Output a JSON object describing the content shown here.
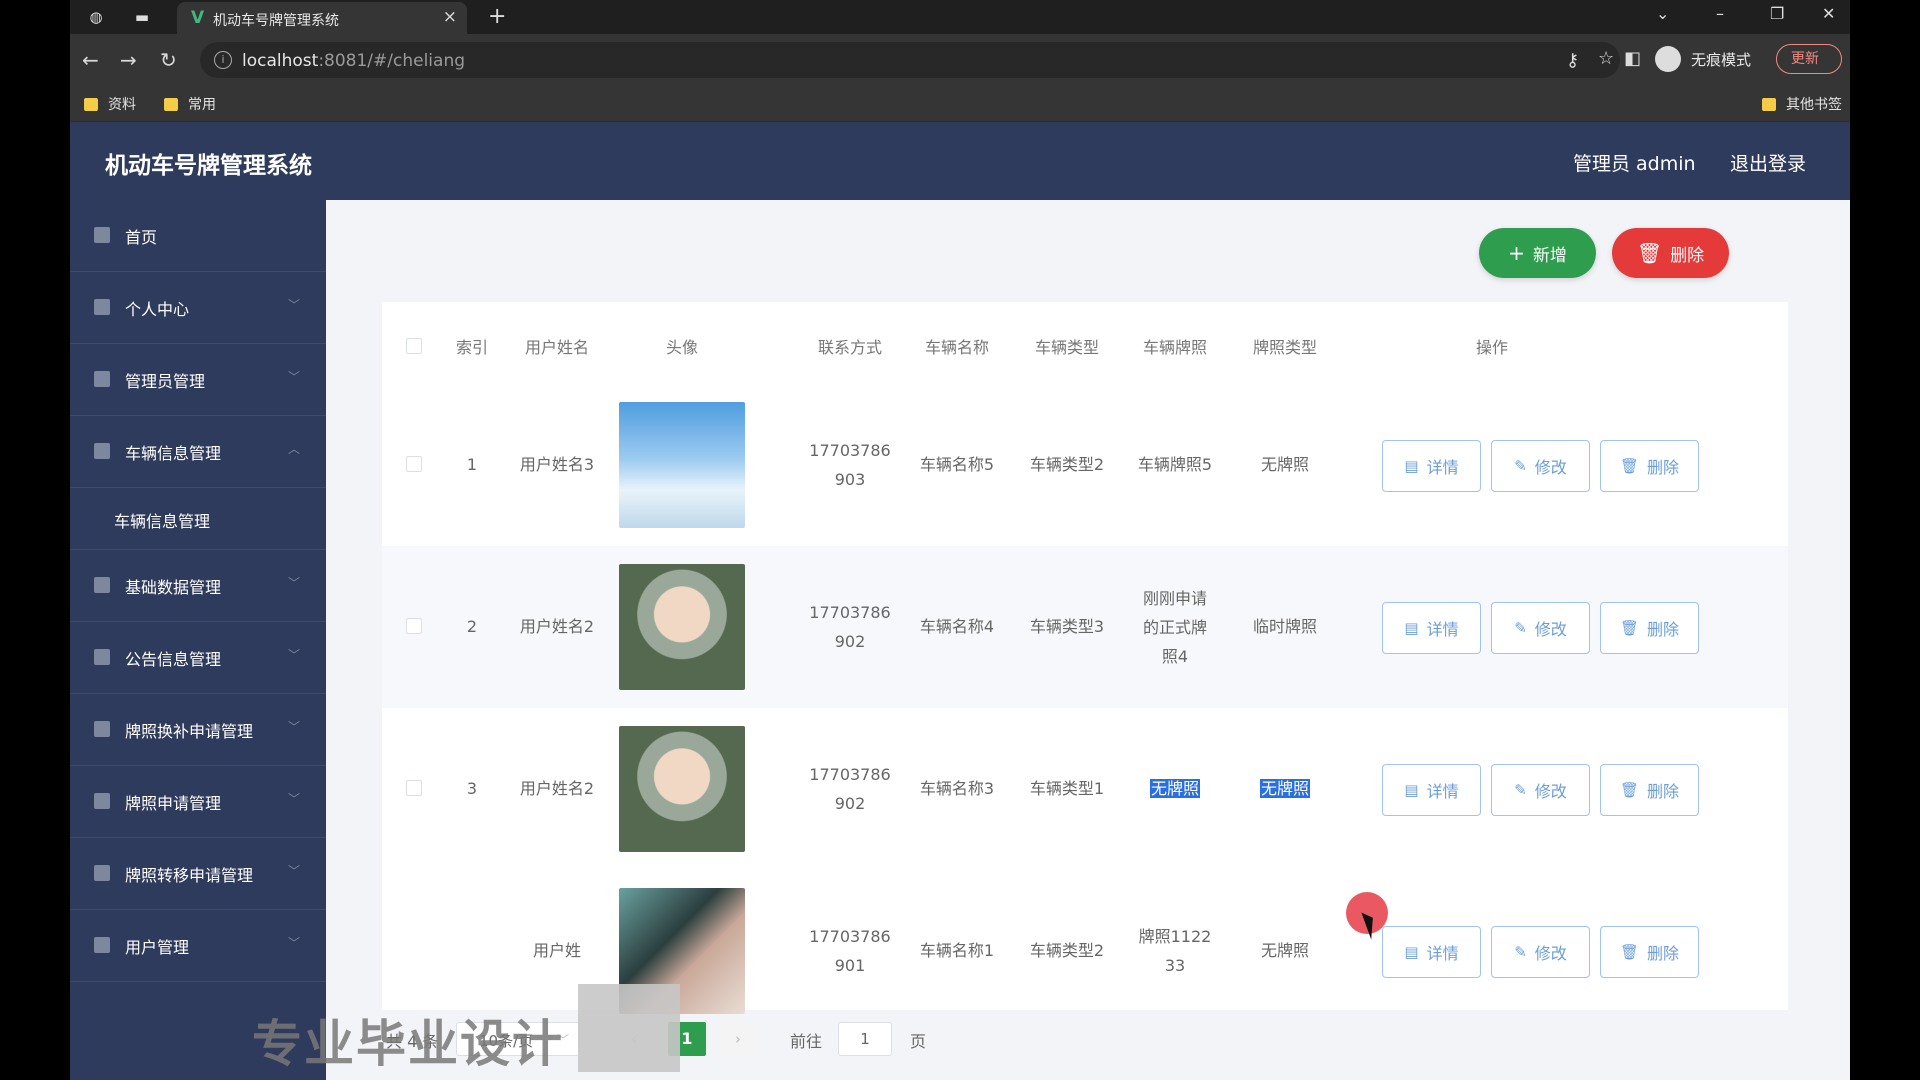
{
  "browser": {
    "tab_title": "机动车号牌管理系统",
    "url_host": "localhost",
    "url_rest": ":8081/#/cheliang",
    "incognito_label": "无痕模式",
    "update_label": "更新",
    "bookmarks": [
      "资料",
      "常用"
    ],
    "other_bookmarks": "其他书签"
  },
  "header": {
    "title": "机动车号牌管理系统",
    "admin": "管理员 admin",
    "logout": "退出登录"
  },
  "sidebar": {
    "items": [
      {
        "label": "首页",
        "icon": "home-icon"
      },
      {
        "label": "个人中心",
        "icon": "user-icon"
      },
      {
        "label": "管理员管理",
        "icon": "monitor-icon"
      },
      {
        "label": "车辆信息管理",
        "icon": "chat-icon"
      },
      {
        "label": "车辆信息管理",
        "icon": ""
      },
      {
        "label": "基础数据管理",
        "icon": "flag-icon"
      },
      {
        "label": "公告信息管理",
        "icon": "pin-icon"
      },
      {
        "label": "牌照换补申请管理",
        "icon": "send-icon"
      },
      {
        "label": "牌照申请管理",
        "icon": "clipboard-icon"
      },
      {
        "label": "牌照转移申请管理",
        "icon": "power-icon"
      },
      {
        "label": "用户管理",
        "icon": "edit-icon"
      }
    ]
  },
  "toolbar": {
    "add_label": "新增",
    "delete_label": "删除"
  },
  "table": {
    "headers": [
      "索引",
      "用户姓名",
      "头像",
      "联系方式",
      "车辆名称",
      "车辆类型",
      "车辆牌照",
      "牌照类型",
      "操作"
    ],
    "rows": [
      {
        "index": "1",
        "name": "用户姓名3",
        "phone1": "17703786",
        "phone2": "903",
        "vehicle": "车辆名称5",
        "type": "车辆类型2",
        "plate": "车辆牌照5",
        "plate2": "",
        "plate3": "",
        "plate_type": "无牌照"
      },
      {
        "index": "2",
        "name": "用户姓名2",
        "phone1": "17703786",
        "phone2": "902",
        "vehicle": "车辆名称4",
        "type": "车辆类型3",
        "plate": "刚刚申请",
        "plate2": "的正式牌",
        "plate3": "照4",
        "plate_type": "临时牌照"
      },
      {
        "index": "3",
        "name": "用户姓名2",
        "phone1": "17703786",
        "phone2": "902",
        "vehicle": "车辆名称3",
        "type": "车辆类型1",
        "plate": "无牌照",
        "plate2": "",
        "plate3": "",
        "plate_type": "无牌照"
      },
      {
        "index": "",
        "name": "用户姓",
        "phone1": "17703786",
        "phone2": "901",
        "vehicle": "车辆名称1",
        "type": "车辆类型2",
        "plate": "牌照1122",
        "plate2": "33",
        "plate3": "",
        "plate_type": "无牌照"
      }
    ],
    "actions": {
      "detail": "详情",
      "edit": "修改",
      "delete": "删除"
    }
  },
  "pager": {
    "total": "共 4 条",
    "page_size": "10条/页",
    "current": "1",
    "goto_label": "前往",
    "goto_value": "1",
    "unit": "页"
  },
  "overlay": {
    "watermark": "专业毕业设计"
  },
  "colors": {
    "header_bg": "#2f3b5c",
    "add_button": "#2e9d4e",
    "delete_button": "#e53a3a",
    "action_border": "#9fc3f2"
  }
}
